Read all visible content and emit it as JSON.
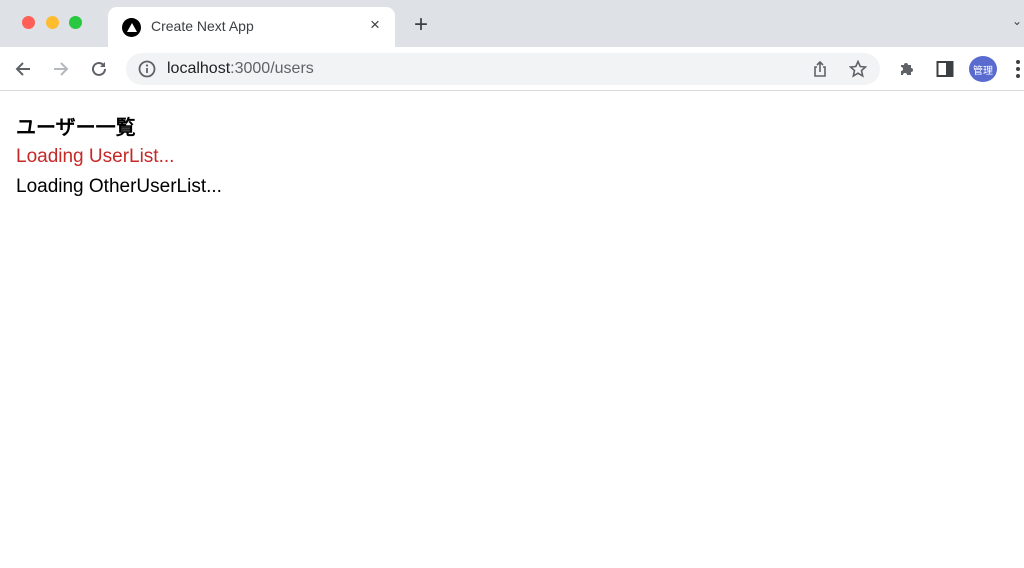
{
  "browser": {
    "tab": {
      "title": "Create Next App",
      "favicon": "nextjs-triangle-icon",
      "close_label": "×"
    },
    "new_tab_label": "+",
    "tab_menu_label": "⌄",
    "address": {
      "host": "localhost",
      "rest": ":3000/users"
    },
    "profile_label": "管理",
    "colors": {
      "avatar": "#5a6bd0",
      "tabbar": "#dee1e6"
    }
  },
  "page": {
    "title": "ユーザー一覧",
    "loading_userlist": "Loading UserList...",
    "loading_other_userlist": "Loading OtherUserList...",
    "colors": {
      "loading_userlist": "#c62828",
      "loading_other": "#000000"
    }
  }
}
